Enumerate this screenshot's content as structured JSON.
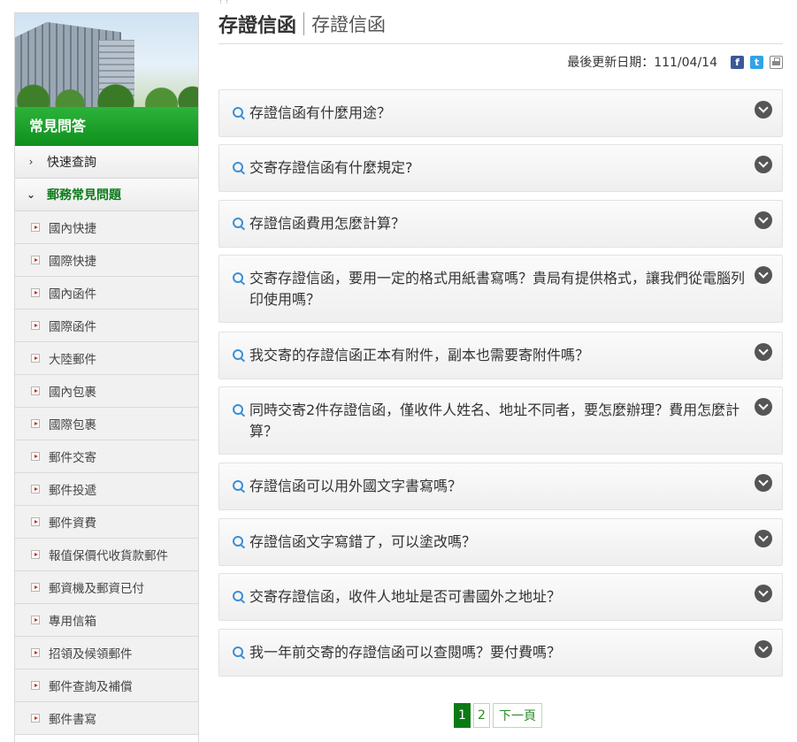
{
  "sidebar": {
    "title": "常見問答",
    "top_items": [
      {
        "label": "快速查詢",
        "chevron": "›"
      },
      {
        "label": "郵務常見問題",
        "chevron": "⌄"
      }
    ],
    "sub_items": [
      "國內快捷",
      "國際快捷",
      "國內函件",
      "國際函件",
      "大陸郵件",
      "國內包裹",
      "國際包裹",
      "郵件交寄",
      "郵件投遞",
      "郵件資費",
      "報值保價代收貨款郵件",
      "郵資機及郵資已付",
      "專用信箱",
      "招領及候領郵件",
      "郵件查詢及補償",
      "郵件書寫"
    ]
  },
  "header": {
    "title": "存證信函",
    "subtitle": "存證信函",
    "updated_label": "最後更新日期：111/04/14",
    "share": {
      "facebook": "f",
      "twitter": "t"
    }
  },
  "faqs": [
    "存證信函有什麼用途？",
    "交寄存證信函有什麼規定?",
    "存證信函費用怎麼計算？",
    "交寄存證信函，要用一定的格式用紙書寫嗎？貴局有提供格式，讓我們從電腦列印使用嗎？",
    "我交寄的存證信函正本有附件，副本也需要寄附件嗎？",
    "同時交寄2件存證信函，僅收件人姓名、地址不同者，要怎麼辦理？費用怎麼計算？",
    "存證信函可以用外國文字書寫嗎？",
    "存證信函文字寫錯了，可以塗改嗎？",
    "交寄存證信函，收件人地址是否可書國外之地址？",
    "我一年前交寄的存證信函可以查閱嗎？要付費嗎？"
  ],
  "pager": {
    "pages": [
      "1",
      "2"
    ],
    "current": "1",
    "next_label": "下一頁"
  }
}
